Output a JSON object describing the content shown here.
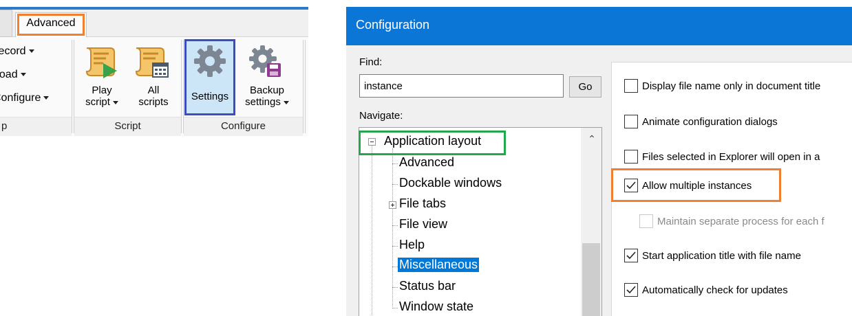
{
  "ribbon": {
    "tabs": {
      "advanced": "Advanced"
    },
    "menu": [
      {
        "label": "Record",
        "has_caret": true
      },
      {
        "label": "Load",
        "has_caret": true
      },
      {
        "label": "Configure",
        "has_caret": true
      }
    ],
    "buttons": {
      "play_script_line1": "Play",
      "play_script_line2": "script",
      "all_scripts_line1": "All",
      "all_scripts_line2": "scripts",
      "settings": "Settings",
      "backup_line1": "Backup",
      "backup_line2": "settings"
    },
    "groups": {
      "first_tail": "p",
      "script": "Script",
      "configure": "Configure"
    },
    "icons": [
      "play-script-icon",
      "all-scripts-icon",
      "settings-gear-icon",
      "backup-settings-icon"
    ]
  },
  "dialog": {
    "title": "Configuration",
    "find_label": "Find:",
    "find_value": "instance",
    "go_label": "Go",
    "navigate_label": "Navigate:",
    "tree": {
      "root": "Application layout",
      "children": [
        {
          "label": "Advanced",
          "expandable": false,
          "selected": false
        },
        {
          "label": "Dockable windows",
          "expandable": false,
          "selected": false
        },
        {
          "label": "File tabs",
          "expandable": true,
          "selected": false
        },
        {
          "label": "File view",
          "expandable": false,
          "selected": false
        },
        {
          "label": "Help",
          "expandable": false,
          "selected": false
        },
        {
          "label": "Miscellaneous",
          "expandable": false,
          "selected": true
        },
        {
          "label": "Status bar",
          "expandable": false,
          "selected": false
        },
        {
          "label": "Window state",
          "expandable": false,
          "selected": false
        }
      ]
    },
    "options": [
      {
        "label": "Display file name only in document title",
        "checked": false,
        "enabled": true
      },
      {
        "label": "Animate configuration dialogs",
        "checked": false,
        "enabled": true
      },
      {
        "label": "Files selected in Explorer will open in a",
        "checked": false,
        "enabled": true
      },
      {
        "label": "Allow multiple instances",
        "checked": true,
        "enabled": true
      },
      {
        "label": "Maintain separate process for each f",
        "checked": false,
        "enabled": false
      },
      {
        "label": "Start application title with file name",
        "checked": true,
        "enabled": true
      },
      {
        "label": "Automatically check for updates",
        "checked": true,
        "enabled": true
      }
    ],
    "highlight_colors": {
      "orange": "#ef8032",
      "green": "#22a84a",
      "blue": "#3b4cc0",
      "accent": "#0b76d6"
    }
  }
}
